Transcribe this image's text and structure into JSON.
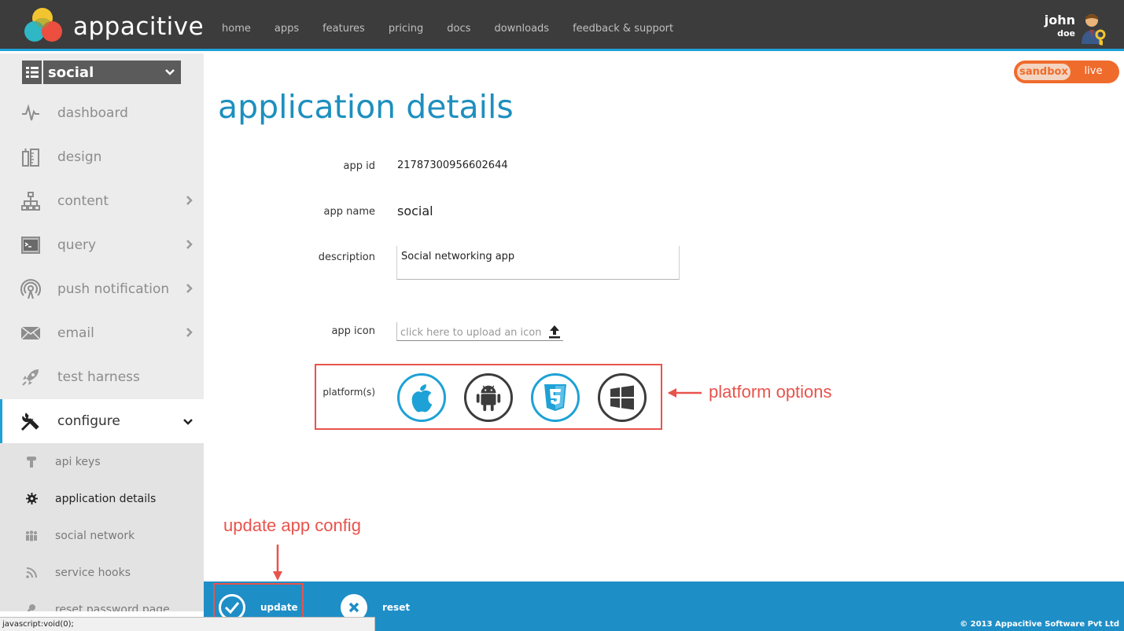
{
  "header": {
    "brand": "appacitive",
    "nav": [
      "home",
      "apps",
      "features",
      "pricing",
      "docs",
      "downloads",
      "feedback & support"
    ],
    "user_first": "john",
    "user_last": "doe"
  },
  "sidebar": {
    "app_name": "social",
    "items": [
      {
        "label": "dashboard",
        "icon": "pulse-icon",
        "has_children": false
      },
      {
        "label": "design",
        "icon": "ruler-icon",
        "has_children": false
      },
      {
        "label": "content",
        "icon": "hierarchy-icon",
        "has_children": true
      },
      {
        "label": "query",
        "icon": "terminal-icon",
        "has_children": true
      },
      {
        "label": "push notification",
        "icon": "broadcast-icon",
        "has_children": true
      },
      {
        "label": "email",
        "icon": "envelope-icon",
        "has_children": true
      },
      {
        "label": "test harness",
        "icon": "rocket-icon",
        "has_children": false
      },
      {
        "label": "configure",
        "icon": "tools-icon",
        "has_children": true,
        "active": true
      }
    ],
    "subitems": [
      {
        "label": "api keys",
        "icon": "key-icon"
      },
      {
        "label": "application details",
        "icon": "gear-icon",
        "current": true
      },
      {
        "label": "social network",
        "icon": "people-icon"
      },
      {
        "label": "service hooks",
        "icon": "rss-icon"
      },
      {
        "label": "reset password page",
        "icon": "key-icon"
      }
    ]
  },
  "env": {
    "sandbox": "sandbox",
    "live": "live",
    "selected": "sandbox"
  },
  "main": {
    "title": "application details",
    "app_id_label": "app id",
    "app_id": "21787300956602644",
    "app_name_label": "app name",
    "app_name": "social",
    "description_label": "description",
    "description": "Social networking app",
    "app_icon_label": "app icon",
    "app_icon_placeholder": "click here to upload an icon",
    "platforms_label": "platform(s)",
    "platforms": [
      {
        "name": "ios",
        "icon": "apple-icon",
        "color": "#1ea1d6"
      },
      {
        "name": "android",
        "icon": "android-icon",
        "color": "#3c3c3c"
      },
      {
        "name": "html5",
        "icon": "html5-icon",
        "color": "#1ea1d6"
      },
      {
        "name": "windows",
        "icon": "windows-icon",
        "color": "#3c3c3c"
      }
    ]
  },
  "callouts": {
    "platform": "platform options",
    "update": "update app config"
  },
  "footer": {
    "update": "update",
    "reset": "reset",
    "copyright": "© 2013 Appacitive Software Pvt Ltd"
  },
  "status_bar": "javascript:void(0);",
  "colors": {
    "accent": "#1ea1d6",
    "header": "#3c3c3c",
    "orange": "#ef6b2b",
    "annotation": "#e8534c"
  }
}
